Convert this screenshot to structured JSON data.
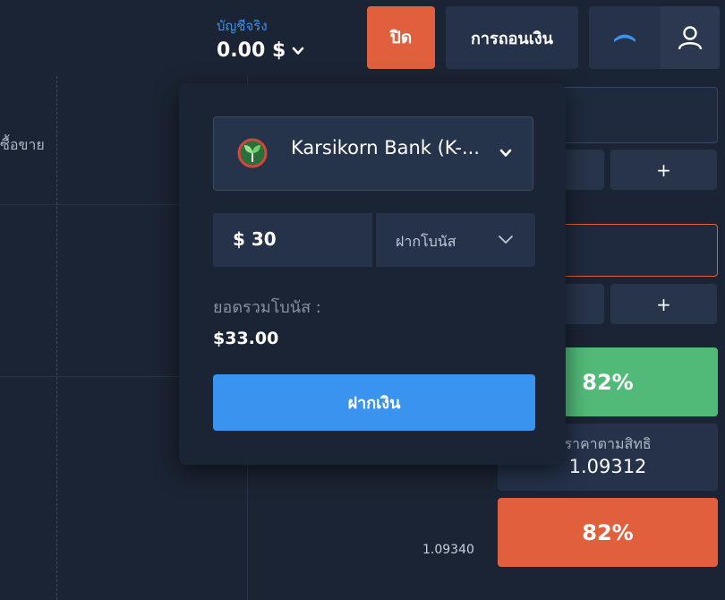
{
  "chart": {
    "side_label": "ซื้อขาย",
    "price_tick": "1.09340"
  },
  "header": {
    "account_type": "บัญชีจริง",
    "balance": "0.00 $",
    "close_label": "ปิด",
    "withdraw_label": "การถอนเงิน"
  },
  "deposit_popup": {
    "bank_name": "Karsikorn Bank (K-...",
    "amount": "$ 30",
    "bonus_option": "ฝากโบนัส",
    "total_bonus_label": "ยอดรวมโบนัส :",
    "total_bonus_value": "$33.00",
    "deposit_label": "ฝากเงิน"
  },
  "trade_panel": {
    "plus_label": "+",
    "up_payout": "82%",
    "strike_label": "ราคาตามสิทธิ",
    "strike_value": "1.09312",
    "down_payout": "82%"
  },
  "colors": {
    "background": "#1b2434",
    "accent_blue": "#3a93ef",
    "up_green": "#52ba78",
    "down_orange": "#e0603d"
  },
  "icons": [
    "chevron-down-icon",
    "collapse-icon",
    "user-icon",
    "kasikorn-logo-icon"
  ]
}
